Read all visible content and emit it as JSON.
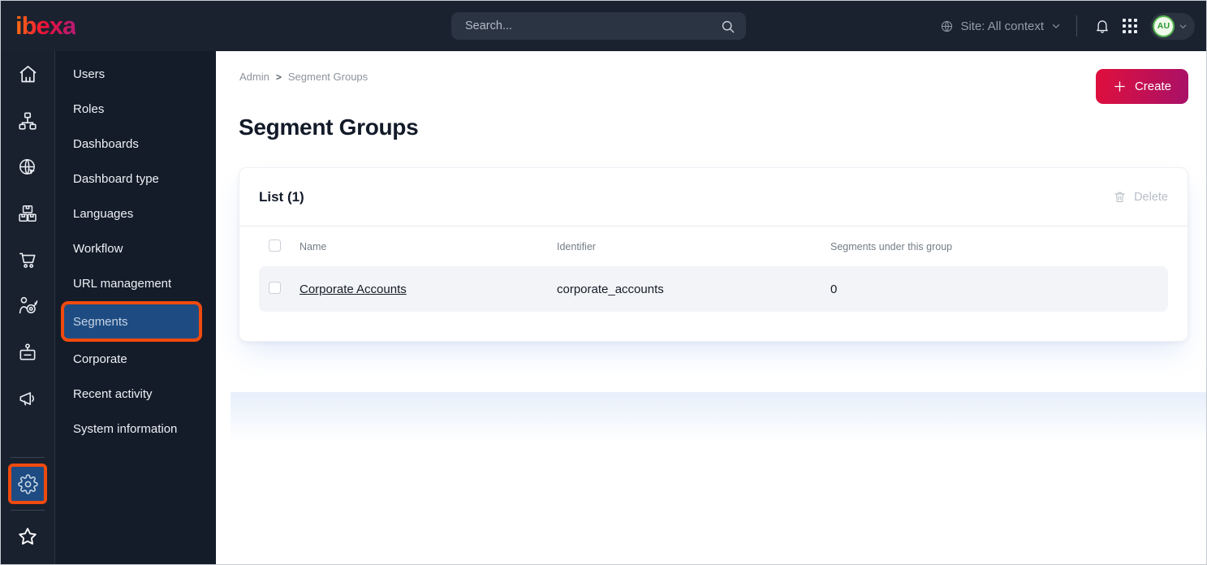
{
  "topbar": {
    "logo": "ibexa",
    "search_placeholder": "Search...",
    "site_context_label": "Site: All context",
    "avatar_initials": "AU",
    "icons": [
      "globe-icon",
      "chevron-down-icon",
      "bell-icon",
      "app-grid-icon"
    ]
  },
  "rail": {
    "icons": [
      "home-icon",
      "content-tree-icon",
      "site-globe-icon",
      "product-boxes-icon",
      "cart-icon",
      "customer-target-icon",
      "id-badge-icon",
      "megaphone-icon",
      "settings-gear-icon",
      "bookmarks-star-icon"
    ],
    "active_icon": "settings-gear-icon"
  },
  "menu": {
    "items": [
      "Users",
      "Roles",
      "Dashboards",
      "Dashboard type",
      "Languages",
      "Workflow",
      "URL management",
      "Segments",
      "Corporate",
      "Recent activity",
      "System information"
    ],
    "active_item": "Segments"
  },
  "main": {
    "breadcrumb": [
      "Admin",
      "Segment Groups"
    ],
    "breadcrumb_separator": ">",
    "title": "Segment Groups",
    "create_label": "Create",
    "list": {
      "title": "List (1)",
      "delete_label": "Delete",
      "columns": [
        "Name",
        "Identifier",
        "Segments under this group"
      ],
      "rows": [
        {
          "name": "Corporate Accounts",
          "identifier": "corporate_accounts",
          "segments": "0"
        }
      ]
    }
  },
  "colors": {
    "topbar_bg": "#1A2230",
    "sidebar_bg": "#141C2A",
    "highlight_orange": "#F04A0E",
    "active_blue": "#1E4C82",
    "create_gradient_start": "#E00F3C",
    "create_gradient_end": "#A81168",
    "avatar_green": "#2E9733",
    "row_bg": "#F3F4F7"
  }
}
